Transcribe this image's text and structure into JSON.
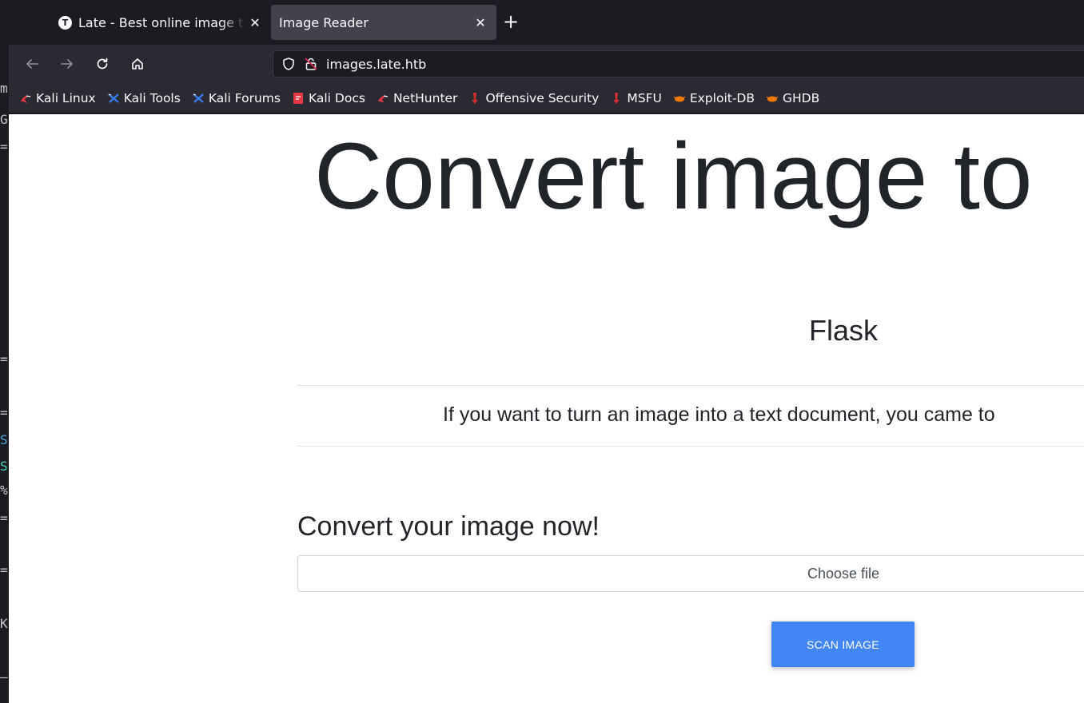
{
  "background_strip": {
    "glyphs": [
      "m",
      "G",
      "=",
      "=",
      "=",
      "S",
      "S",
      "%",
      "=",
      "=",
      "K",
      "—"
    ]
  },
  "browser": {
    "tabs": [
      {
        "label": "Late - Best online image to",
        "favicon_letter": "T",
        "active": false
      },
      {
        "label": "Image Reader",
        "active": true
      }
    ],
    "new_tab_symbol": "+",
    "url": "images.late.htb",
    "bookmarks": [
      {
        "label": "Kali Linux",
        "icon": "kali-dragon-icon",
        "color": "#e63946"
      },
      {
        "label": "Kali Tools",
        "icon": "kali-tools-icon",
        "color": "#367bf0"
      },
      {
        "label": "Kali Forums",
        "icon": "kali-forums-icon",
        "color": "#367bf0"
      },
      {
        "label": "Kali Docs",
        "icon": "kali-docs-icon",
        "color": "#e63946"
      },
      {
        "label": "NetHunter",
        "icon": "kali-dragon-icon",
        "color": "#e63946"
      },
      {
        "label": "Offensive Security",
        "icon": "offsec-icon",
        "color": "#d32f2f"
      },
      {
        "label": "MSFU",
        "icon": "offsec-icon",
        "color": "#d32f2f"
      },
      {
        "label": "Exploit-DB",
        "icon": "exploitdb-icon",
        "color": "#f57c00"
      },
      {
        "label": "GHDB",
        "icon": "exploitdb-icon",
        "color": "#f57c00"
      }
    ]
  },
  "page": {
    "hero_title": "Convert image to",
    "framework": "Flask",
    "lead": "If you want to turn an image into a text document, you came to",
    "upload_heading": "Convert your image now!",
    "file_input_label": "Choose file",
    "scan_button": "SCAN IMAGE",
    "accent_color": "#4285f4"
  }
}
